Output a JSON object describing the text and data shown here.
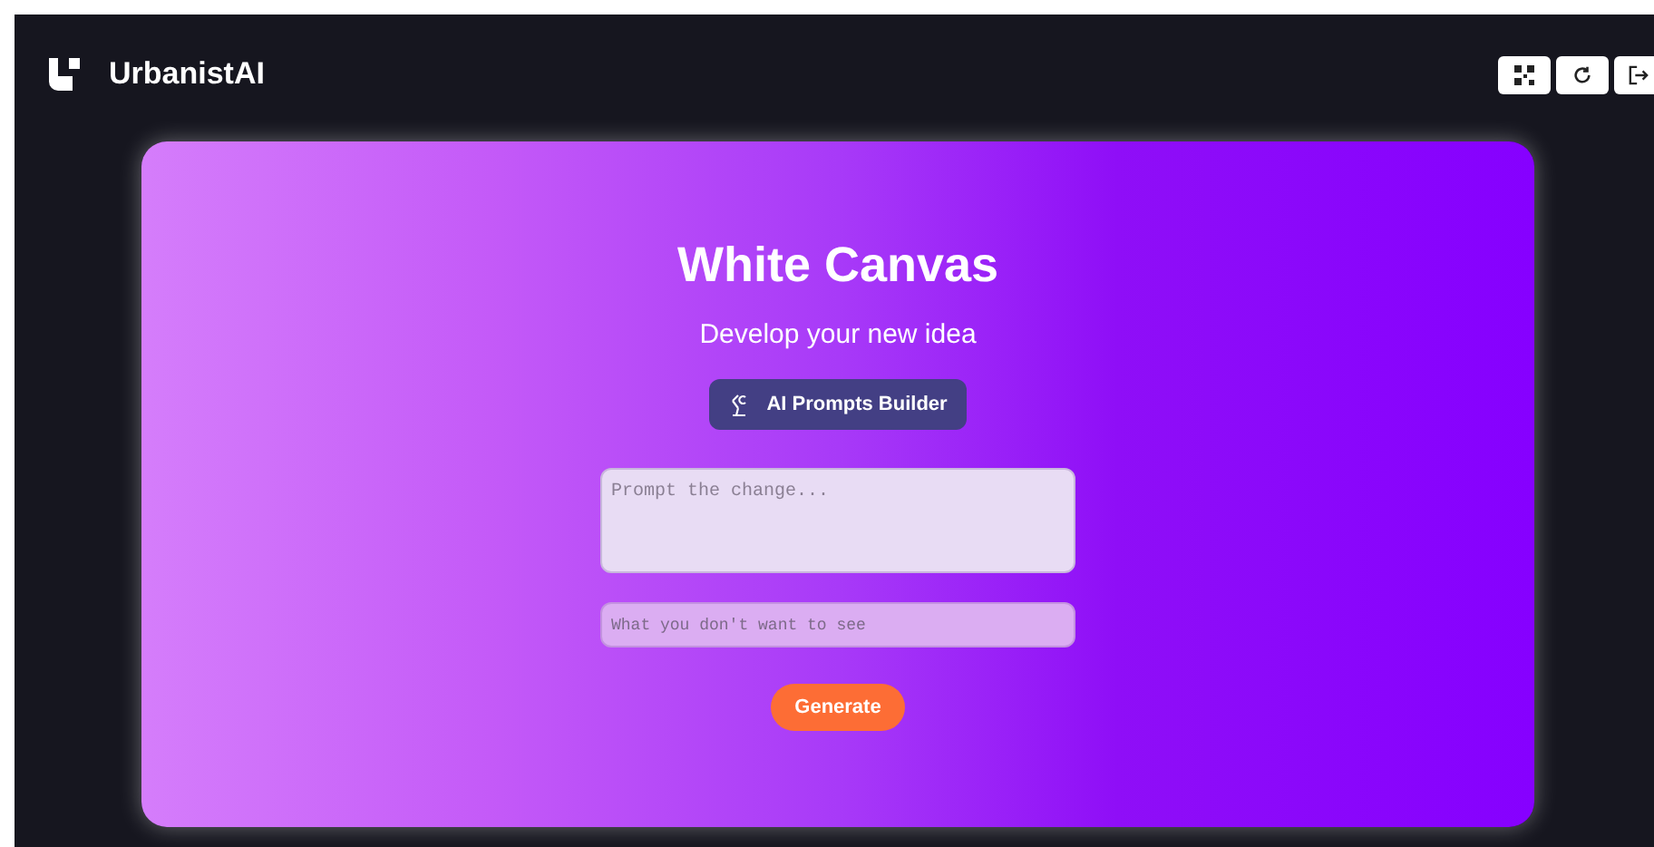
{
  "header": {
    "brand": "UrbanistAI"
  },
  "card": {
    "title": "White Canvas",
    "subtitle": "Develop your new idea",
    "builder_button": "AI Prompts Builder",
    "prompt": {
      "placeholder": "Prompt the change..."
    },
    "negative": {
      "placeholder": "What you don't want to see"
    },
    "generate_button": "Generate"
  }
}
